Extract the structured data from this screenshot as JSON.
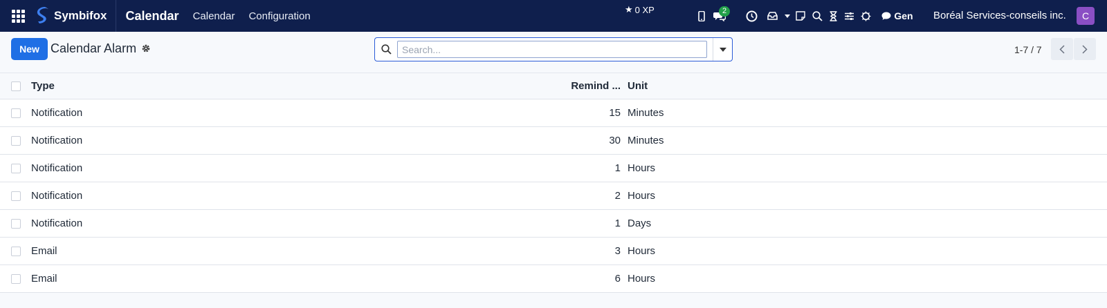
{
  "navbar": {
    "brand": "Symbifox",
    "app_title": "Calendar",
    "menu": [
      "Calendar",
      "Configuration"
    ],
    "xp": "0 XP",
    "messages_badge": "2",
    "gen": "Gen",
    "company": "Boréal Services-conseils inc.",
    "avatar_initial": "C"
  },
  "control": {
    "new_label": "New",
    "title": "Calendar Alarm",
    "search_placeholder": "Search...",
    "pager": "1-7 / 7"
  },
  "table": {
    "headers": {
      "type": "Type",
      "remind": "Remind ...",
      "unit": "Unit"
    },
    "rows": [
      {
        "type": "Notification",
        "remind": "15",
        "unit": "Minutes"
      },
      {
        "type": "Notification",
        "remind": "30",
        "unit": "Minutes"
      },
      {
        "type": "Notification",
        "remind": "1",
        "unit": "Hours"
      },
      {
        "type": "Notification",
        "remind": "2",
        "unit": "Hours"
      },
      {
        "type": "Notification",
        "remind": "1",
        "unit": "Days"
      },
      {
        "type": "Email",
        "remind": "3",
        "unit": "Hours"
      },
      {
        "type": "Email",
        "remind": "6",
        "unit": "Hours"
      }
    ]
  },
  "colors": {
    "navbar_bg": "#0f1f4d",
    "primary": "#1f6fe5",
    "badge": "#22a04a",
    "avatar": "#8a4fc4"
  }
}
